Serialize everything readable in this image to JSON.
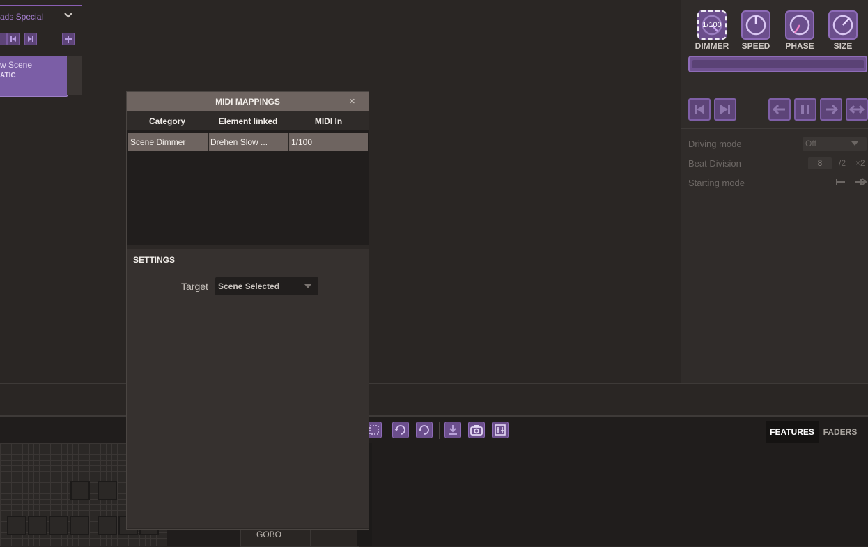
{
  "left_panel": {
    "group_title": "ads Special",
    "scene_name": "w Scene",
    "scene_type": "ATIC"
  },
  "right_panel": {
    "knobs": [
      {
        "label": "DIMMER",
        "value": "1/100",
        "icon": "dimmer-knob-icon"
      },
      {
        "label": "SPEED",
        "icon": "speed-knob-icon"
      },
      {
        "label": "PHASE",
        "icon": "phase-knob-icon"
      },
      {
        "label": "SIZE",
        "icon": "size-knob-icon"
      }
    ],
    "settings": {
      "driving_mode_label": "Driving mode",
      "driving_mode_value": "Off",
      "beat_division_label": "Beat Division",
      "beat_division_value": "8",
      "beat_div_half": "/2",
      "beat_div_double": "×2",
      "starting_mode_label": "Starting mode"
    }
  },
  "modal": {
    "title": "MIDI MAPPINGS",
    "close": "×",
    "columns": [
      "Category",
      "Element linked",
      "MIDI In"
    ],
    "rows": [
      {
        "category": "Scene Dimmer",
        "element": "Drehen Slow ...",
        "midi_in": "1/100"
      }
    ],
    "settings_title": "SETTINGS",
    "target_label": "Target",
    "target_value": "Scene Selected"
  },
  "bottom": {
    "gobo_label": "GOBO",
    "tabs": [
      "FEATURES",
      "FADERS"
    ]
  },
  "colors": {
    "accent": "#8e6cb8",
    "accent_dark": "#6b4e8c",
    "background": "#2a2624"
  }
}
